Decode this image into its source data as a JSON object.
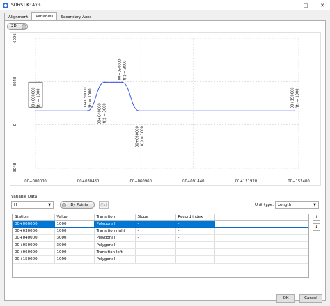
{
  "window": {
    "title": "SOFiSTiK: Axis"
  },
  "tabs": [
    {
      "label": "Alignment"
    },
    {
      "label": "Variables"
    },
    {
      "label": "Secondary Axes"
    }
  ],
  "toolbar": {
    "mode_label": "2D"
  },
  "chart_data": {
    "type": "line",
    "title": "",
    "xlabel": "",
    "ylabel": "",
    "x": [
      0,
      30000,
      40000,
      50000,
      60000,
      150000
    ],
    "y": [
      1000,
      1000,
      3000,
      3000,
      1000,
      1000
    ],
    "xlim": [
      0,
      152400
    ],
    "ylim": [
      -3048,
      6096
    ],
    "x_ticks": [
      "00+000000",
      "00+030480",
      "00+060960",
      "00+091440",
      "00+121920",
      "00+152400"
    ],
    "y_ticks": [
      "-3048",
      "0",
      "3048",
      "6096"
    ],
    "line_color": "#3b55e6",
    "annotations": [
      {
        "station": "00+000000",
        "value": "f(t) = 1000",
        "boxed": true
      },
      {
        "station": "00+030000",
        "value": "f(t) = 1000"
      },
      {
        "station": "00+040000",
        "value": "f(t) = 3000"
      },
      {
        "station": "00+050000",
        "value": "f(t) = 3000"
      },
      {
        "station": "00+060000",
        "value": "f(t) = 1000"
      },
      {
        "station": "00+150000",
        "value": "f(t) = 1000"
      }
    ]
  },
  "variable_data": {
    "section_label": "Variable Data",
    "variable_value": "H",
    "by_points_label": "By Points",
    "fx_label": "f(x)",
    "unit_type_label": "Unit type:",
    "unit_type_value": "Length"
  },
  "table": {
    "columns": [
      "Station",
      "Value",
      "Transition",
      "Slope",
      "Record index"
    ],
    "rows": [
      [
        "00+000000",
        "1000",
        "Polygonal",
        "-",
        "-"
      ],
      [
        "00+030000",
        "1000",
        "Transition right",
        "-",
        "-"
      ],
      [
        "00+040000",
        "3000",
        "Polygonal",
        "-",
        "-"
      ],
      [
        "00+050000",
        "3000",
        "Polygonal",
        "-",
        "-"
      ],
      [
        "00+060000",
        "1000",
        "Transition left",
        "-",
        "-"
      ],
      [
        "00+150000",
        "1000",
        "Polygonal",
        "-",
        "-"
      ]
    ],
    "selected_row": 0
  },
  "side_buttons": {
    "up": "↑",
    "down": "↓"
  },
  "footer": {
    "ok_label": "OK",
    "cancel_label": "Cancel"
  }
}
